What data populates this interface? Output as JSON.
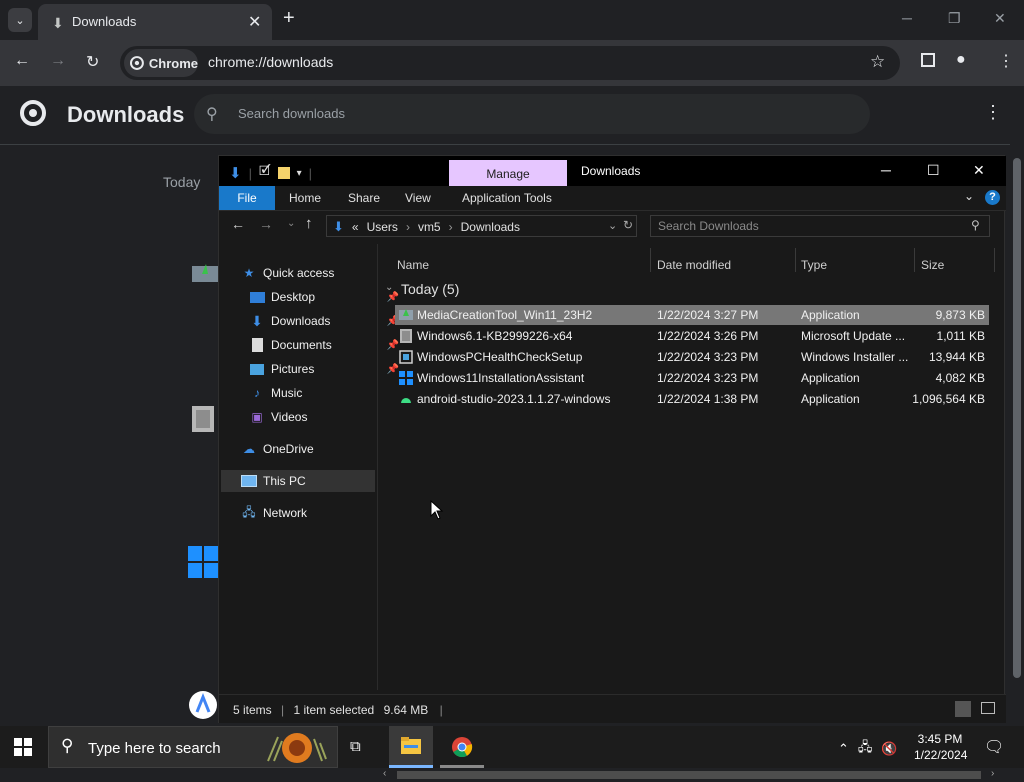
{
  "browser": {
    "tab_title": "Downloads",
    "chip_label": "Chrome",
    "url": "chrome://downloads"
  },
  "downloads_page": {
    "title": "Downloads",
    "search_placeholder": "Search downloads",
    "section_today": "Today"
  },
  "explorer": {
    "window_title": "Downloads",
    "manage_tab": "Manage",
    "ribbon_tabs": [
      "File",
      "Home",
      "Share",
      "View",
      "Application Tools"
    ],
    "breadcrumb": [
      "«",
      "Users",
      "vm5",
      "Downloads"
    ],
    "search_placeholder": "Search Downloads",
    "nav": {
      "quick_access": "Quick access",
      "desktop": "Desktop",
      "downloads": "Downloads",
      "documents": "Documents",
      "pictures": "Pictures",
      "music": "Music",
      "videos": "Videos",
      "onedrive": "OneDrive",
      "this_pc": "This PC",
      "network": "Network"
    },
    "columns": [
      "Name",
      "Date modified",
      "Type",
      "Size"
    ],
    "group_label": "Today (5)",
    "files": [
      {
        "name": "MediaCreationTool_Win11_23H2",
        "date": "1/22/2024 3:27 PM",
        "type": "Application",
        "size": "9,873 KB",
        "icon": "app-installer-icon"
      },
      {
        "name": "Windows6.1-KB2999226-x64",
        "date": "1/22/2024 3:26 PM",
        "type": "Microsoft Update ...",
        "size": "1,011 KB",
        "icon": "update-package-icon"
      },
      {
        "name": "WindowsPCHealthCheckSetup",
        "date": "1/22/2024 3:23 PM",
        "type": "Windows Installer ...",
        "size": "13,944 KB",
        "icon": "msi-installer-icon"
      },
      {
        "name": "Windows11InstallationAssistant",
        "date": "1/22/2024 3:23 PM",
        "type": "Application",
        "size": "4,082 KB",
        "icon": "windows-logo-icon"
      },
      {
        "name": "android-studio-2023.1.1.27-windows",
        "date": "1/22/2024 1:38 PM",
        "type": "Application",
        "size": "1,096,564 KB",
        "icon": "android-icon"
      }
    ],
    "status": {
      "items": "5 items",
      "selected": "1 item selected",
      "size": "9.64 MB"
    }
  },
  "taskbar": {
    "search_placeholder": "Type here to search",
    "time": "3:45 PM",
    "date": "1/22/2024"
  },
  "colors": {
    "accent_blue": "#1979ca",
    "manage_tab": "#e6c6ff",
    "selected_row": "#777777"
  }
}
